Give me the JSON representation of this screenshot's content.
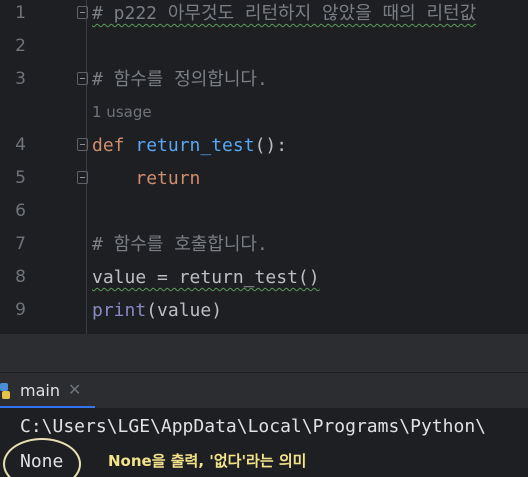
{
  "editor": {
    "lines": [
      {
        "num": "1",
        "comment": "# p222 아무것도 리턴하지 않았을 때의 리턴값"
      },
      {
        "num": "2"
      },
      {
        "num": "3",
        "comment": "# 함수를 정의합니다."
      },
      {
        "usage": "1 usage"
      },
      {
        "num": "4",
        "def_kw": "def",
        "fn_name": "return_test",
        "rest": "():"
      },
      {
        "num": "5",
        "ret_kw": "return"
      },
      {
        "num": "6"
      },
      {
        "num": "7",
        "comment": "# 함수를 호출합니다."
      },
      {
        "num": "8",
        "code": "value = return_test()"
      },
      {
        "num": "9",
        "builtin": "print",
        "rest": "(value)"
      }
    ]
  },
  "run_panel": {
    "tab_label": "main",
    "close_glyph": "✕",
    "output_path": "C:\\Users\\LGE\\AppData\\Local\\Programs\\Python\\",
    "output_value": "None",
    "annotation": "None을 출력, '없다'라는 의미"
  },
  "colors": {
    "accent": "#3574f0",
    "annotation": "#f3e38a",
    "keyword": "#cf8e6d",
    "function": "#56a8f5"
  }
}
